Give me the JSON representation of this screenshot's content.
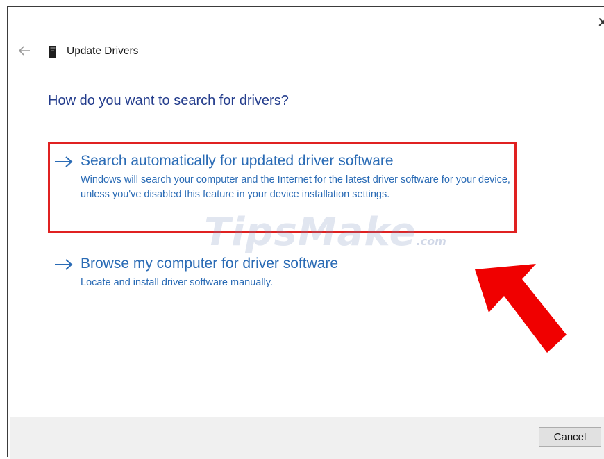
{
  "window": {
    "close_glyph": "✕",
    "title": "Update Drivers"
  },
  "icons": {
    "back": "back-arrow-icon",
    "device": "device-icon",
    "option_arrow": "right-arrow-icon",
    "annotation": "red-pointer-arrow-icon"
  },
  "main": {
    "heading": "How do you want to search for drivers?",
    "options": [
      {
        "title": "Search automatically for updated driver software",
        "description": "Windows will search your computer and the Internet for the latest driver software for your device, unless you've disabled this feature in your device installation settings."
      },
      {
        "title": "Browse my computer for driver software",
        "description": "Locate and install driver software manually."
      }
    ]
  },
  "footer": {
    "cancel_label": "Cancel"
  },
  "watermark": {
    "text": "TipsMake",
    "domain": ".com"
  },
  "colors": {
    "heading": "#233c8c",
    "link": "#2a6bb5",
    "highlight": "#e02121",
    "annotation_arrow": "#f00000"
  }
}
